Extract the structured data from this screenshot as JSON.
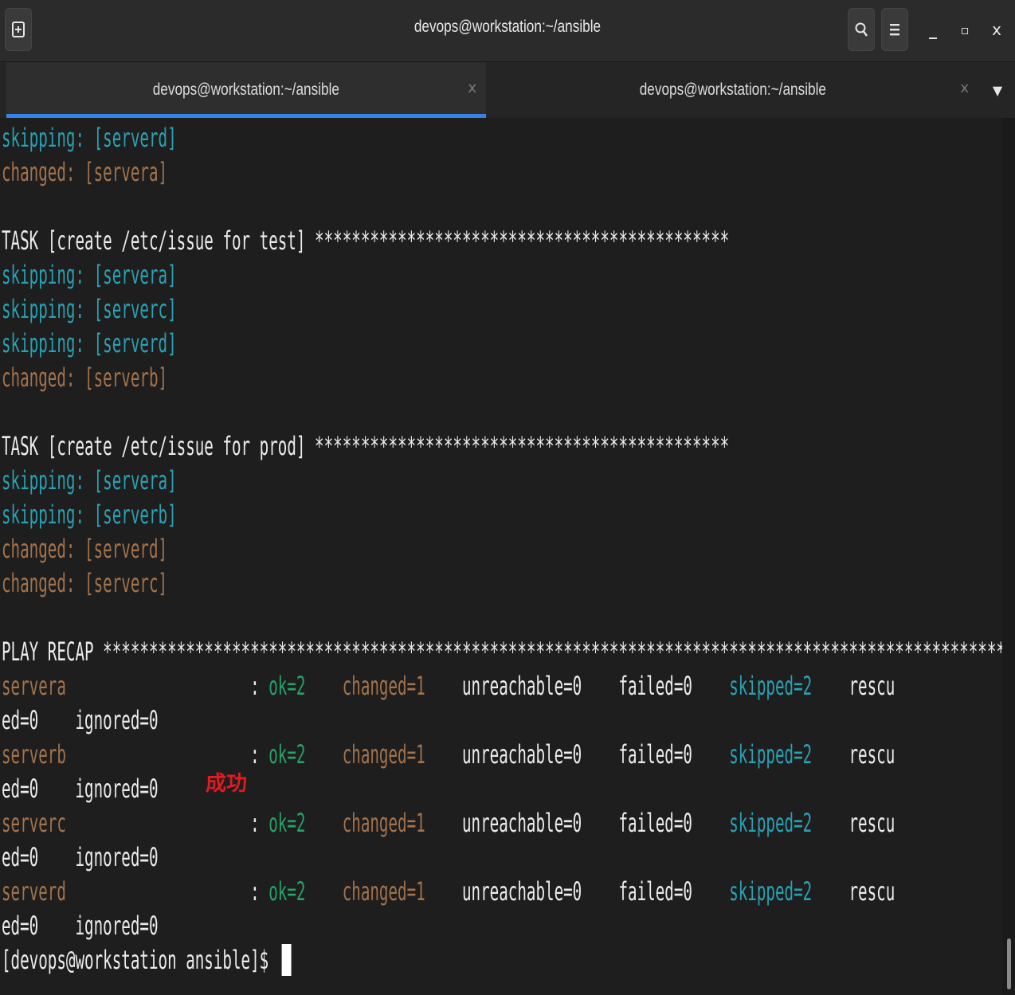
{
  "window": {
    "title": "devops@workstation:~/ansible"
  },
  "tabs": [
    {
      "label": "devops@workstation:~/ansible",
      "close": "x",
      "active": true
    },
    {
      "label": "devops@workstation:~/ansible",
      "close": "x",
      "active": false
    }
  ],
  "controls": {
    "minimize": "_",
    "maximize": "▫",
    "close": "x",
    "tab_menu": "▼"
  },
  "terminal": {
    "lines": [
      {
        "segments": [
          {
            "t": "skipping: [serverd]",
            "c": "cyan"
          }
        ]
      },
      {
        "segments": [
          {
            "t": "changed: [servera]",
            "c": "amber"
          }
        ]
      },
      {
        "segments": [
          {
            "t": "TASK [create /etc/issue for test] *********************************************",
            "c": "white"
          }
        ]
      },
      {
        "segments": [
          {
            "t": "skipping: [servera]",
            "c": "cyan"
          }
        ]
      },
      {
        "segments": [
          {
            "t": "skipping: [serverc]",
            "c": "cyan"
          }
        ]
      },
      {
        "segments": [
          {
            "t": "skipping: [serverd]",
            "c": "cyan"
          }
        ]
      },
      {
        "segments": [
          {
            "t": "changed: [serverb]",
            "c": "amber"
          }
        ]
      },
      {
        "segments": [
          {
            "t": "TASK [create /etc/issue for prod] *********************************************",
            "c": "white"
          }
        ]
      },
      {
        "segments": [
          {
            "t": "skipping: [servera]",
            "c": "cyan"
          }
        ]
      },
      {
        "segments": [
          {
            "t": "skipping: [serverb]",
            "c": "cyan"
          }
        ]
      },
      {
        "segments": [
          {
            "t": "changed: [serverd]",
            "c": "amber"
          }
        ]
      },
      {
        "segments": [
          {
            "t": "changed: [serverc]",
            "c": "amber"
          }
        ]
      },
      {
        "segments": [
          {
            "t": "PLAY RECAP *****************************************************************************************************************",
            "c": "white"
          }
        ]
      },
      {
        "segments": [
          {
            "t": "servera",
            "c": "amber"
          },
          {
            "t": "                    : ",
            "c": "white"
          },
          {
            "t": "ok=2",
            "c": "green"
          },
          {
            "t": "    ",
            "c": "white"
          },
          {
            "t": "changed=1",
            "c": "amber"
          },
          {
            "t": "    unreachable=0    failed=0    ",
            "c": "white"
          },
          {
            "t": "skipped=2",
            "c": "cyan"
          },
          {
            "t": "    rescu",
            "c": "white"
          }
        ]
      },
      {
        "segments": [
          {
            "t": "ed=0    ignored=0",
            "c": "white"
          }
        ]
      },
      {
        "segments": [
          {
            "t": "serverb",
            "c": "amber"
          },
          {
            "t": "                    : ",
            "c": "white"
          },
          {
            "t": "ok=2",
            "c": "green"
          },
          {
            "t": "    ",
            "c": "white"
          },
          {
            "t": "changed=1",
            "c": "amber"
          },
          {
            "t": "    unreachable=0    failed=0    ",
            "c": "white"
          },
          {
            "t": "skipped=2",
            "c": "cyan"
          },
          {
            "t": "    rescu",
            "c": "white"
          }
        ]
      },
      {
        "segments": [
          {
            "t": "ed=0    ignored=0",
            "c": "white"
          }
        ]
      },
      {
        "segments": [
          {
            "t": "serverc",
            "c": "amber"
          },
          {
            "t": "                    : ",
            "c": "white"
          },
          {
            "t": "ok=2",
            "c": "green"
          },
          {
            "t": "    ",
            "c": "white"
          },
          {
            "t": "changed=1",
            "c": "amber"
          },
          {
            "t": "    unreachable=0    failed=0    ",
            "c": "white"
          },
          {
            "t": "skipped=2",
            "c": "cyan"
          },
          {
            "t": "    rescu",
            "c": "white"
          }
        ]
      },
      {
        "segments": [
          {
            "t": "ed=0    ignored=0",
            "c": "white"
          }
        ]
      },
      {
        "segments": [
          {
            "t": "serverd",
            "c": "amber"
          },
          {
            "t": "                    : ",
            "c": "white"
          },
          {
            "t": "ok=2",
            "c": "green"
          },
          {
            "t": "    ",
            "c": "white"
          },
          {
            "t": "changed=1",
            "c": "amber"
          },
          {
            "t": "    unreachable=0    failed=0    ",
            "c": "white"
          },
          {
            "t": "skipped=2",
            "c": "cyan"
          },
          {
            "t": "    rescu",
            "c": "white"
          }
        ]
      },
      {
        "segments": [
          {
            "t": "ed=0    ignored=0",
            "c": "white"
          }
        ]
      },
      {
        "segments": [
          {
            "t": "[devops@workstation ansible]$ ",
            "c": "white"
          }
        ],
        "cursor": true
      }
    ]
  },
  "annotation": {
    "text": "成功",
    "color": "#e01b24"
  },
  "colors": {
    "skipping": "#2aa1b3",
    "changed": "#a2734c",
    "ok": "#26a269",
    "text": "#ececec",
    "background": "#1e1e1e",
    "tab_accent": "#3584e4"
  }
}
